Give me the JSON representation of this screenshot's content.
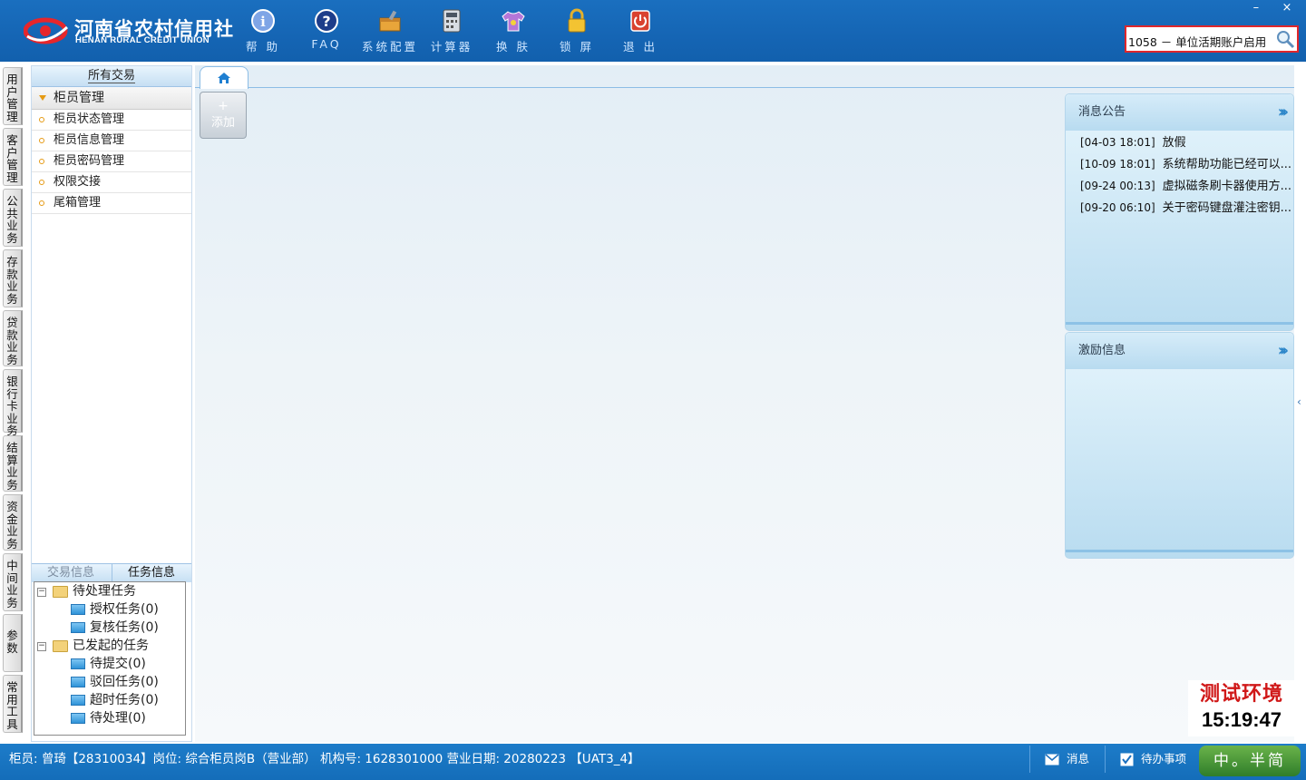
{
  "app": {
    "logo_cn": "河南省农村信用社",
    "logo_en": "HENAN RURAL CREDIT UNION"
  },
  "toolbar": [
    {
      "label": "帮 助",
      "icon": "help-icon"
    },
    {
      "label": "FAQ",
      "icon": "faq-icon"
    },
    {
      "label": "系统配置",
      "icon": "toolbox-icon"
    },
    {
      "label": "计算器",
      "icon": "calculator-icon"
    },
    {
      "label": "换 肤",
      "icon": "shirt-icon"
    },
    {
      "label": "锁 屏",
      "icon": "lock-icon"
    },
    {
      "label": "退 出",
      "icon": "power-icon"
    }
  ],
  "window_controls": {
    "minimize": "–",
    "close": "×"
  },
  "search": {
    "value": "1058 － 单位活期账户启用"
  },
  "vertical_tabs": [
    "用户管理",
    "客户管理",
    "公共业务",
    "存款业务",
    "贷款业务",
    "银行卡业务",
    "结算业务",
    "资金业务",
    "中间业务",
    "参数",
    "常用工具"
  ],
  "left_panel": {
    "header": "所有交易",
    "group": "柜员管理",
    "items": [
      "柜员状态管理",
      "柜员信息管理",
      "柜员密码管理",
      "权限交接",
      "尾箱管理"
    ],
    "bottom_tabs": [
      "交易信息",
      "任务信息"
    ],
    "tree": {
      "pending": "待处理任务",
      "pending_children": [
        "授权任务(0)",
        "复核任务(0)"
      ],
      "initiated": "已发起的任务",
      "initiated_children": [
        "待提交(0)",
        "驳回任务(0)",
        "超时任务(0)",
        "待处理(0)"
      ]
    }
  },
  "main": {
    "add_label": "添加",
    "add_plus": "+",
    "notice": {
      "title": "消息公告",
      "messages": [
        {
          "time": "[04-03 18:01]",
          "text": "放假"
        },
        {
          "time": "[10-09 18:01]",
          "text": "系统帮助功能已经可以..."
        },
        {
          "time": "[09-24 00:13]",
          "text": "虚拟磁条刷卡器使用方..."
        },
        {
          "time": "[09-20 06:10]",
          "text": "关于密码键盘灌注密钥..."
        }
      ]
    },
    "incentive": {
      "title": "激励信息"
    }
  },
  "environment": {
    "label": "测试环境",
    "clock": "15:19:47"
  },
  "status": {
    "info": "柜员: 曾琦【28310034】岗位: 综合柜员岗B（营业部） 机构号: 1628301000 营业日期: 20280223 【UAT3_4】",
    "message_btn": "消息",
    "todo_btn": "待办事项",
    "ime": "中。半简"
  },
  "colors": {
    "topbar": "#1565b4",
    "accent_red": "#d01818",
    "status_bar": "#1a75c2"
  }
}
